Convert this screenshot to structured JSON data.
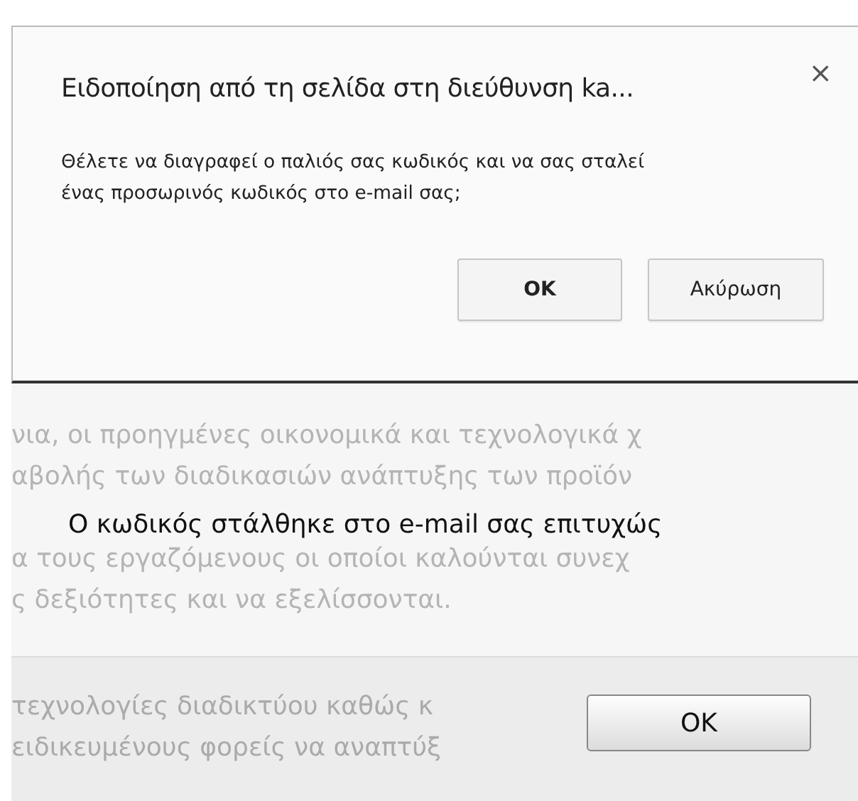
{
  "alert": {
    "title": "Ειδοποίηση από τη σελίδα στη διεύθυνση ka...",
    "close": "×",
    "message": "Θέλετε να διαγραφεί ο παλιός σας κωδικός και να σας σταλεί ένας προσωρινός κωδικός στο e-mail σας;",
    "buttons": [
      {
        "label": "OK",
        "default": true
      },
      {
        "label": "Ακύρωση",
        "default": false
      }
    ]
  },
  "background_text": {
    "lines": [
      "νια, οι προηγμένες οικονομικά και τεχνολογικά χ",
      "αβολής των διαδικασιών ανάπτυξης των προϊόν",
      "α τους εργαζόμενους οι οποίοι καλούνται συνεχ",
      "ς δεξιότητες και να εξελίσσονται."
    ],
    "footer_lines": [
      "τεχνολογίες διαδικτύου καθώς κ",
      "ειδικευμένους φορείς να αναπτύξ"
    ]
  },
  "notice": {
    "message": "Ο κωδικός στάλθηκε στο e-mail σας επιτυχώς",
    "button": "OK"
  }
}
